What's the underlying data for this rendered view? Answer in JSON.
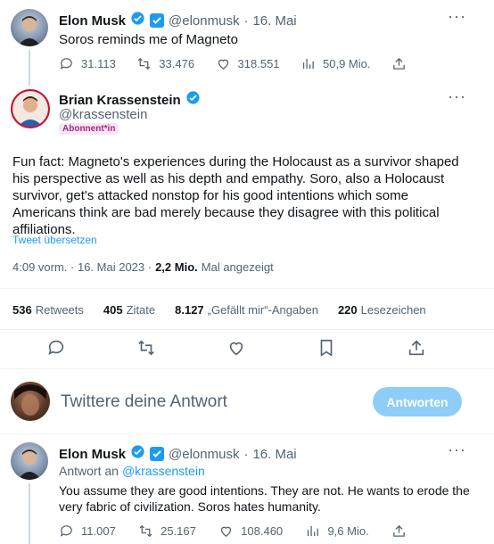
{
  "tweet1": {
    "name": "Elon Musk",
    "handle": "@elonmusk",
    "separator": "·",
    "date": "16. Mai",
    "text": "Soros reminds me of Magneto",
    "replies": "31.113",
    "retweets": "33.476",
    "likes": "318.551",
    "views": "50,9 Mio."
  },
  "main_tweet": {
    "name": "Brian Krassenstein",
    "handle": "@krassenstein",
    "badge": "Abonnent*in",
    "text": "Fun fact:  Magneto's experiences during the Holocaust as a survivor shaped his perspective as well as his depth and empathy.  Soro, also a Holocaust survivor, get's attacked nonstop for his good intentions which some Americans think are bad merely because they disagree with this political affiliations.",
    "translate": "Tweet übersetzen",
    "time": "4:09 vorm. · 16. Mai 2023 ·",
    "views_count": "2,2 Mio.",
    "views_label": "Mal angezeigt",
    "stats": [
      {
        "count": "536",
        "label": "Retweets"
      },
      {
        "count": "405",
        "label": "Zitate"
      },
      {
        "count": "8.127",
        "label": "„Gefällt mir“-Angaben"
      },
      {
        "count": "220",
        "label": "Lesezeichen"
      }
    ]
  },
  "reply_box": {
    "placeholder": "Twittere deine Antwort",
    "button": "Antworten"
  },
  "tweet3": {
    "name": "Elon Musk",
    "handle": "@elonmusk",
    "separator": "·",
    "date": "16. Mai",
    "reply_to_prefix": "Antwort an",
    "reply_to_handle": "@krassenstein",
    "text": "You assume they are good intentions. They are not. He wants to erode the very fabric of civilization. Soros hates humanity.",
    "replies": "11.007",
    "retweets": "25.167",
    "likes": "108.460",
    "views": "9,6 Mio."
  },
  "colors": {
    "accent": "#1d9bf0",
    "button_disabled": "#8ecdf8",
    "muted": "#536471",
    "badge_bg": "#f7e8f3",
    "badge_text": "#b01f83"
  }
}
